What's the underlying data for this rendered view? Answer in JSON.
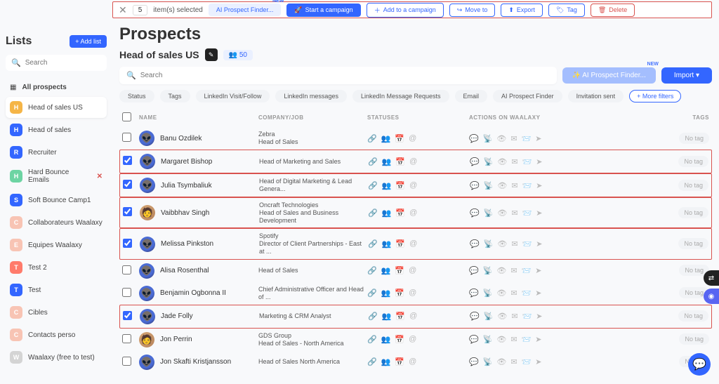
{
  "topbar": {
    "count": "5",
    "label": "item(s) selected",
    "ai_btn": "AI Prospect Finder...",
    "new": "NEW",
    "start": "Start a campaign",
    "add": "Add to a campaign",
    "move": "Move to",
    "export": "Export",
    "tag": "Tag",
    "delete": "Delete"
  },
  "sidebar": {
    "title": "Lists",
    "add": "+  Add list",
    "search_ph": "Search",
    "all": "All prospects",
    "items": [
      {
        "letter": "H",
        "label": "Head of sales US",
        "color": "#f5b547",
        "active": true
      },
      {
        "letter": "H",
        "label": "Head of sales",
        "color": "#3366ff"
      },
      {
        "letter": "R",
        "label": "Recruiter",
        "color": "#3366ff"
      },
      {
        "letter": "H",
        "label": "Hard Bounce Emails",
        "color": "#6dd4a3",
        "x": true
      },
      {
        "letter": "S",
        "label": "Soft Bounce Camp1",
        "color": "#3366ff"
      },
      {
        "letter": "C",
        "label": "Collaborateurs Waalaxy",
        "color": "#f8c4b4"
      },
      {
        "letter": "E",
        "label": "Equipes Waalaxy",
        "color": "#f8c4b4"
      },
      {
        "letter": "T",
        "label": "Test 2",
        "color": "#ff7b6b"
      },
      {
        "letter": "T",
        "label": "Test",
        "color": "#3366ff"
      },
      {
        "letter": "C",
        "label": "Cibles",
        "color": "#f8c4b4"
      },
      {
        "letter": "C",
        "label": "Contacts perso",
        "color": "#f8c4b4"
      },
      {
        "letter": "W",
        "label": "Waalaxy (free to test)",
        "color": "#d4d4d4"
      }
    ]
  },
  "main": {
    "title": "Prospects",
    "list_name": "Head of sales US",
    "count_badge": "👥 50",
    "search_ph": "Search",
    "ai_finder": "✨  AI Prospect Finder...",
    "new": "NEW",
    "import": "Import  ▾",
    "filters": [
      "Status",
      "Tags",
      "LinkedIn Visit/Follow",
      "LinkedIn messages",
      "LinkedIn Message Requests",
      "Email",
      "AI Prospect Finder",
      "Invitation sent"
    ],
    "more_filters": "+  More filters",
    "headers": {
      "name": "NAME",
      "company": "COMPANY/JOB",
      "statuses": "STATUSES",
      "actions": "ACTIONS ON WAALAXY",
      "tags": "TAGS"
    },
    "no_tag": "No tag",
    "rows": [
      {
        "checked": false,
        "boxed": false,
        "name": "Banu Ozdilek",
        "company": "Zebra",
        "job": "Head of Sales",
        "human": false
      },
      {
        "checked": true,
        "boxed": true,
        "name": "Margaret Bishop",
        "company": "",
        "job": "Head of Marketing and Sales",
        "human": false
      },
      {
        "checked": true,
        "boxed": true,
        "name": "Julia Tsymbaliuk",
        "company": "",
        "job": "Head of Digital Marketing & Lead Genera...",
        "human": false
      },
      {
        "checked": true,
        "boxed": true,
        "name": "Vaibbhav Singh",
        "company": "Oncraft Technologies",
        "job": "Head of Sales and Business Development",
        "human": true
      },
      {
        "checked": true,
        "boxed": true,
        "name": "Melissa Pinkston",
        "company": "Spotify",
        "job": "Director of Client Partnerships - East at ...",
        "human": false
      },
      {
        "checked": false,
        "boxed": false,
        "name": "Alisa Rosenthal",
        "company": "",
        "job": "Head of Sales",
        "human": false
      },
      {
        "checked": false,
        "boxed": false,
        "name": "Benjamin Ogbonna II",
        "company": "",
        "job": "Chief Administrative Officer and Head of ...",
        "human": false
      },
      {
        "checked": true,
        "boxed": true,
        "name": "Jade Folly",
        "company": "",
        "job": "Marketing & CRM Analyst",
        "human": false
      },
      {
        "checked": false,
        "boxed": false,
        "name": "Jon Perrin",
        "company": "GDS Group",
        "job": "Head of Sales - North America",
        "human": true
      },
      {
        "checked": false,
        "boxed": false,
        "name": "Jon Skafti Kristjansson",
        "company": "",
        "job": "Head of Sales North America",
        "human": false
      }
    ]
  }
}
